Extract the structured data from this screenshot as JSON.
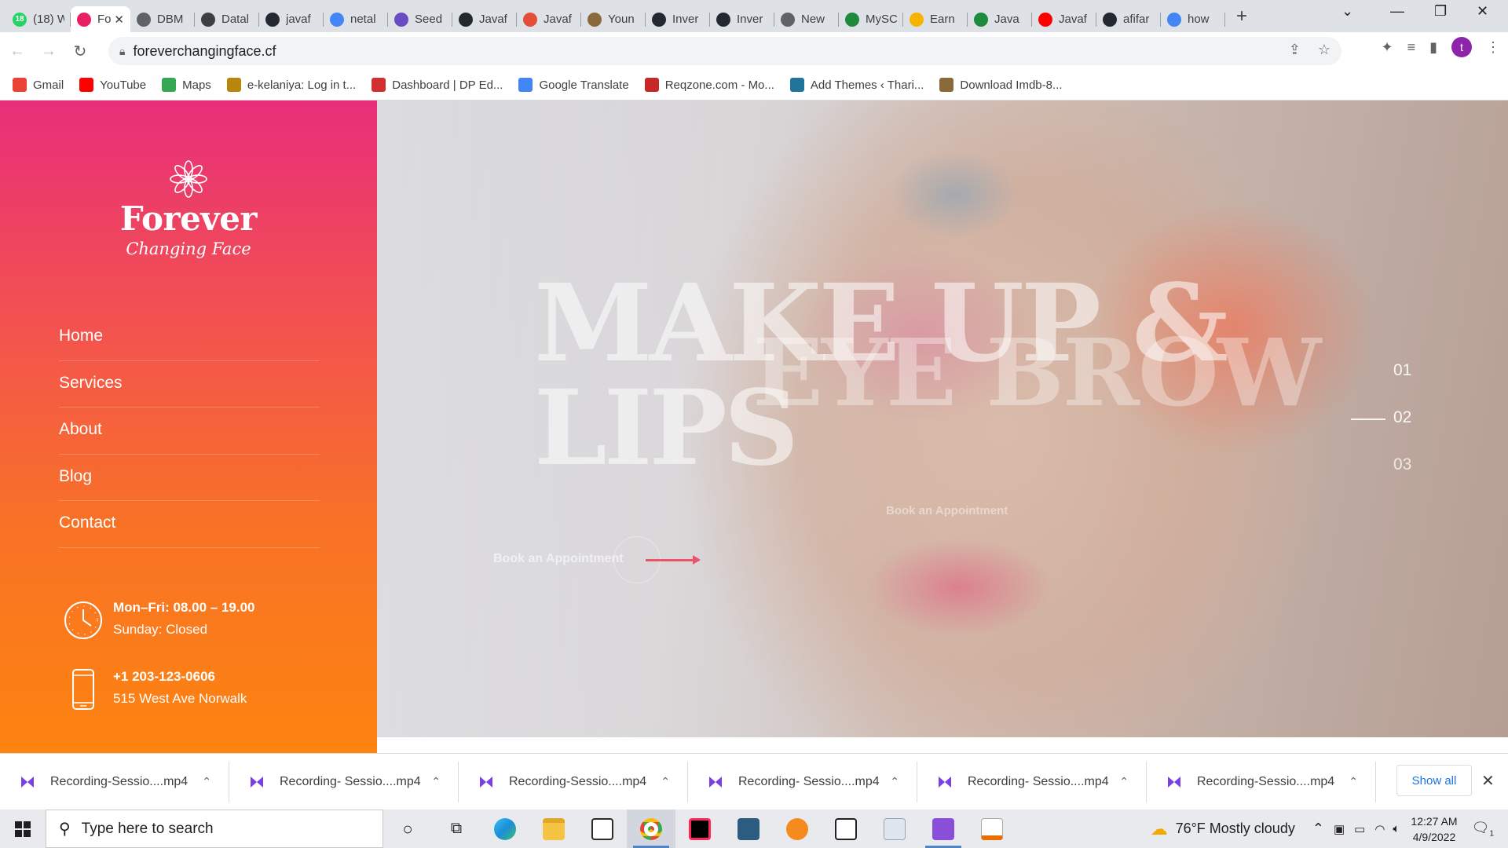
{
  "browser": {
    "tabs": [
      {
        "title": "(18) W",
        "fav_color": "#25d366",
        "fav_text": "18"
      },
      {
        "title": "Fo",
        "fav_color": "#e91e63",
        "active": true
      },
      {
        "title": "DBM",
        "fav_color": "#5f6368"
      },
      {
        "title": "Datal",
        "fav_color": "#3c4043"
      },
      {
        "title": "javaf",
        "fav_color": "#24292f"
      },
      {
        "title": "netal",
        "fav_color": "#4285f4"
      },
      {
        "title": "Seed",
        "fav_color": "#6a4bc4"
      },
      {
        "title": "Javaf",
        "fav_color": "#24292f"
      },
      {
        "title": "Javaf",
        "fav_color": "#e44d3a"
      },
      {
        "title": "Youn",
        "fav_color": "#8a6a3a"
      },
      {
        "title": "Inver",
        "fav_color": "#24292f"
      },
      {
        "title": "Inver",
        "fav_color": "#24292f"
      },
      {
        "title": "New",
        "fav_color": "#5f6368"
      },
      {
        "title": "MySC",
        "fav_color": "#1e8a3c"
      },
      {
        "title": "Earn",
        "fav_color": "#f6b400"
      },
      {
        "title": "Java",
        "fav_color": "#1e8a3c"
      },
      {
        "title": "Javaf",
        "fav_color": "#ff0000"
      },
      {
        "title": "afifar",
        "fav_color": "#24292f"
      },
      {
        "title": "how",
        "fav_color": "#4285f4"
      }
    ],
    "url": "foreverchangingface.cf",
    "bookmarks": [
      {
        "label": "Gmail",
        "color": "#ea4335"
      },
      {
        "label": "YouTube",
        "color": "#ff0000"
      },
      {
        "label": "Maps",
        "color": "#34a853"
      },
      {
        "label": "e-kelaniya: Log in t...",
        "color": "#b8860b"
      },
      {
        "label": "Dashboard | DP Ed...",
        "color": "#d32f2f"
      },
      {
        "label": "Google Translate",
        "color": "#4285f4"
      },
      {
        "label": "Reqzone.com - Mo...",
        "color": "#c62828"
      },
      {
        "label": "Add Themes ‹ Thari...",
        "color": "#21759b"
      },
      {
        "label": "Download Imdb-8...",
        "color": "#8a6a3a"
      }
    ],
    "avatar_letter": "t"
  },
  "site": {
    "brand_title": "Forever",
    "brand_subtitle": "Changing Face",
    "menu": [
      "Home",
      "Services",
      "About",
      "Blog",
      "Contact"
    ],
    "hours_line1": "Mon–Fri: 08.00 – 19.00",
    "hours_line2": "Sunday: Closed",
    "phone": "+1 203-123-0606",
    "address": "515 West Ave Norwalk",
    "hero_text_1": "MAKE UP &",
    "hero_text_2": "LIPS",
    "hero_text_3": "EYE BROW",
    "book_label": "Book an Appointment",
    "book_label_faded": "Book an Appointment",
    "slides": [
      "01",
      "02",
      "03"
    ],
    "active_slide": "02",
    "accent": "#e8556a"
  },
  "downloads": {
    "items": [
      "Recording-Sessio....mp4",
      "Recording- Sessio....mp4",
      "Recording-Sessio....mp4",
      "Recording- Sessio....mp4",
      "Recording- Sessio....mp4",
      "Recording-Sessio....mp4"
    ],
    "show_all": "Show all"
  },
  "taskbar": {
    "search_placeholder": "Type here to search",
    "weather": "76°F  Mostly cloudy",
    "time": "12:27 AM",
    "date": "4/9/2022",
    "notif_count": "1"
  }
}
